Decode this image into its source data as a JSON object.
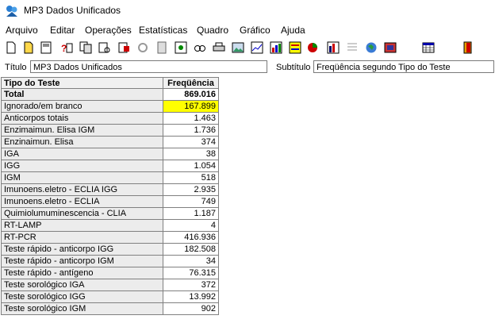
{
  "window": {
    "title": "MP3 Dados Unificados"
  },
  "menu": [
    "Arquivo",
    "Editar",
    "Operações",
    "Estatísticas",
    "Quadro",
    "Gráfico",
    "Ajuda"
  ],
  "fields": {
    "titulo_label": "Título",
    "titulo_value": "MP3 Dados Unificados",
    "subtitulo_label": "Subtítulo",
    "subtitulo_value": "Freqüência segundo Tipo do Teste"
  },
  "table": {
    "headers": [
      "Tipo do Teste",
      "Freqüência"
    ],
    "total": {
      "label": "Total",
      "value": "869.016"
    },
    "rows": [
      {
        "label": "Ignorado/em branco",
        "value": "167.899",
        "highlight": true
      },
      {
        "label": "Anticorpos totais",
        "value": "1.463"
      },
      {
        "label": "Enzimaimun. Elisa IGM",
        "value": "1.736"
      },
      {
        "label": "Enzinaimun. Elisa",
        "value": "374"
      },
      {
        "label": "IGA",
        "value": "38"
      },
      {
        "label": "IGG",
        "value": "1.054"
      },
      {
        "label": "IGM",
        "value": "518"
      },
      {
        "label": "Imunoens.eletro - ECLIA IGG",
        "value": "2.935"
      },
      {
        "label": "Imunoens.eletro - ECLIA",
        "value": "749"
      },
      {
        "label": "Quimiolumuminescencia - CLIA",
        "value": "1.187"
      },
      {
        "label": "RT-LAMP",
        "value": "4"
      },
      {
        "label": "RT-PCR",
        "value": "416.936"
      },
      {
        "label": "Teste rápido - anticorpo IGG",
        "value": "182.508"
      },
      {
        "label": "Teste rápido - anticorpo IGM",
        "value": "34"
      },
      {
        "label": "Teste rápido - antígeno",
        "value": "76.315"
      },
      {
        "label": "Teste sorológico IGA",
        "value": "372"
      },
      {
        "label": "Teste sorológico IGG",
        "value": "13.992"
      },
      {
        "label": "Teste sorológico IGM",
        "value": "902"
      }
    ]
  },
  "toolbar_icons": [
    "new-file-icon",
    "open-file-icon",
    "save-icon",
    "help-icon",
    "copy-icon",
    "find-icon",
    "paste-icon",
    "refresh-icon",
    "calculator-icon",
    "settings-icon",
    "print-preview-icon",
    "print-icon",
    "image-icon",
    "line-chart-icon",
    "bar-chart-icon",
    "table-chart-icon",
    "pie-chart-icon",
    "histogram-icon",
    "list-icon",
    "globe-icon",
    "map-icon",
    "spreadsheet-icon",
    "exit-door-icon"
  ],
  "colors": {
    "highlight": "#ffff00",
    "header_bg": "#f0f0f0",
    "row_shade": "#ececec"
  }
}
